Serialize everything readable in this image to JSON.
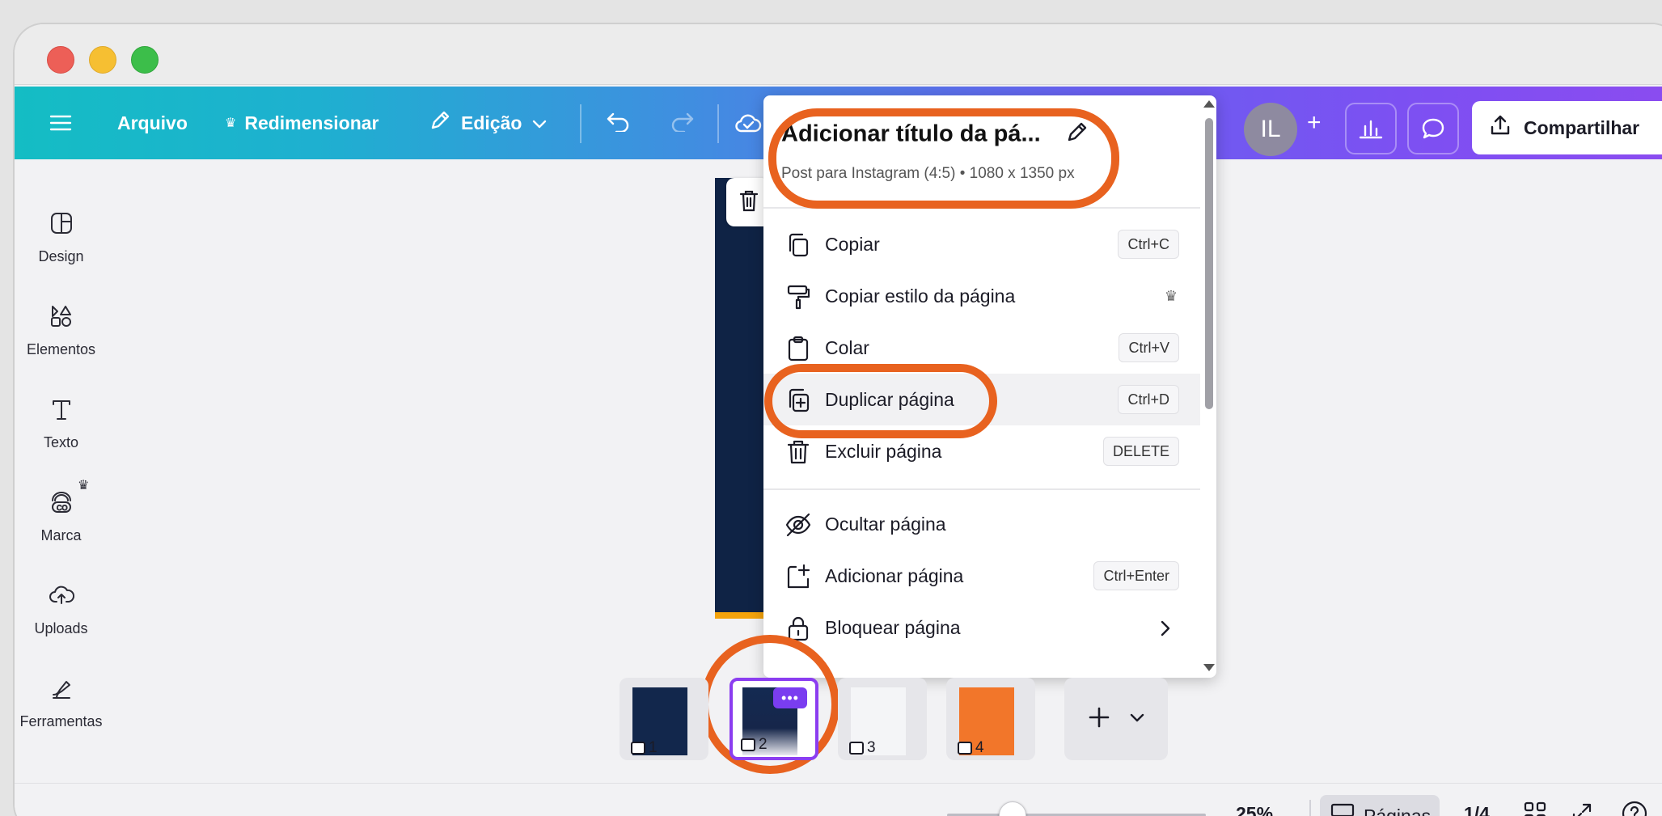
{
  "toolbar": {
    "menu_icon": "hamburger-icon",
    "file": "Arquivo",
    "resize": "Redimensionar",
    "edit": "Edição",
    "avatar_initials": "IL",
    "share": "Compartilhar"
  },
  "sidebar": {
    "items": [
      {
        "label": "Design",
        "icon": "design-icon"
      },
      {
        "label": "Elementos",
        "icon": "elements-icon"
      },
      {
        "label": "Texto",
        "icon": "text-icon"
      },
      {
        "label": "Marca",
        "icon": "brand-icon"
      },
      {
        "label": "Uploads",
        "icon": "upload-icon"
      },
      {
        "label": "Ferramentas",
        "icon": "tools-icon"
      }
    ]
  },
  "context_menu": {
    "title": "Adicionar título da pá...",
    "subtitle": "Post para Instagram (4:5) • 1080 x 1350 px",
    "items": [
      {
        "label": "Copiar",
        "shortcut": "Ctrl+C",
        "icon": "copy-icon"
      },
      {
        "label": "Copiar estilo da página",
        "shortcut": "",
        "icon": "paint-roller-icon"
      },
      {
        "label": "Colar",
        "shortcut": "Ctrl+V",
        "icon": "clipboard-icon"
      },
      {
        "label": "Duplicar página",
        "shortcut": "Ctrl+D",
        "icon": "duplicate-icon"
      },
      {
        "label": "Excluir página",
        "shortcut": "DELETE",
        "icon": "trash-icon"
      },
      {
        "label": "Ocultar página",
        "shortcut": "",
        "icon": "eye-off-icon"
      },
      {
        "label": "Adicionar página",
        "shortcut": "Ctrl+Enter",
        "icon": "add-page-icon"
      },
      {
        "label": "Bloquear página",
        "shortcut": "",
        "icon": "lock-icon"
      }
    ]
  },
  "pages": {
    "thumbnails": [
      "1",
      "2",
      "3",
      "4"
    ],
    "selected": "2",
    "more_dots": "•••"
  },
  "bottom_bar": {
    "zoom": "25%",
    "zoom_level": 0.25,
    "pages_label": "Páginas",
    "page_count": "1/4"
  },
  "colors": {
    "accent_purple": "#8b3df0",
    "annotation_orange": "#e8621f",
    "toolbar_start": "#14bdc4",
    "toolbar_end": "#8b4cf0"
  }
}
